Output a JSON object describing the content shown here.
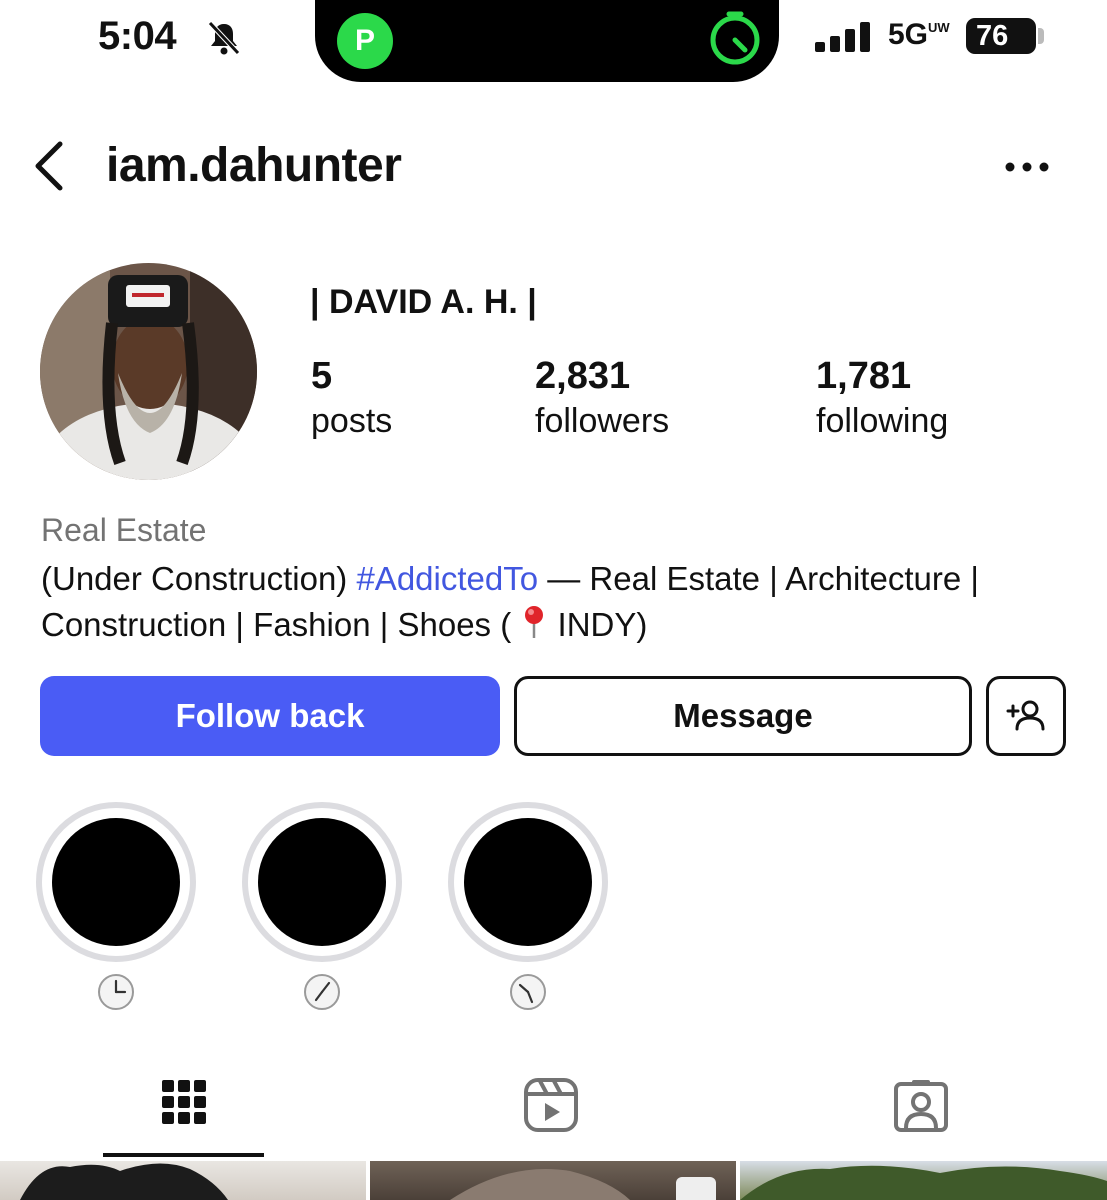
{
  "status_bar": {
    "time": "5:04",
    "network": "5G",
    "network_suffix": "UW",
    "battery": "76",
    "icons": [
      "bell-slash-icon",
      "app-p-icon",
      "timer-icon",
      "signal-bars-icon",
      "battery-icon"
    ]
  },
  "header": {
    "username": "iam.dahunter",
    "back_icon": "chevron-left-icon",
    "more_icon": "ellipsis-icon"
  },
  "profile": {
    "display_name": "| DAVID A. H. |",
    "stats": [
      {
        "value": "5",
        "label": "posts"
      },
      {
        "value": "2,831",
        "label": "followers"
      },
      {
        "value": "1,781",
        "label": "following"
      }
    ],
    "category": "Real Estate",
    "bio": {
      "before_hashtag": "(Under Construction) ",
      "hashtag": "#AddictedTo",
      "after_hashtag": " — Real Estate | Architecture | Construction | Fashion | Shoes ( ",
      "location": "INDY)"
    }
  },
  "actions": {
    "follow_back": "Follow back",
    "message": "Message",
    "add_user_icon": "add-person-icon"
  },
  "highlights": [
    {
      "icon": "clock-icon"
    },
    {
      "icon": "clock-icon"
    },
    {
      "icon": "clock-icon"
    }
  ],
  "tabs": [
    {
      "icon": "grid-icon",
      "selected": true
    },
    {
      "icon": "reels-icon",
      "selected": false
    },
    {
      "icon": "tagged-icon",
      "selected": false
    }
  ],
  "colors": {
    "follow_button": "#4a5cf5",
    "hashtag": "#4257e0",
    "category": "#737373",
    "highlight_ring": "#dcdce0",
    "island_green": "#2bd94a"
  }
}
